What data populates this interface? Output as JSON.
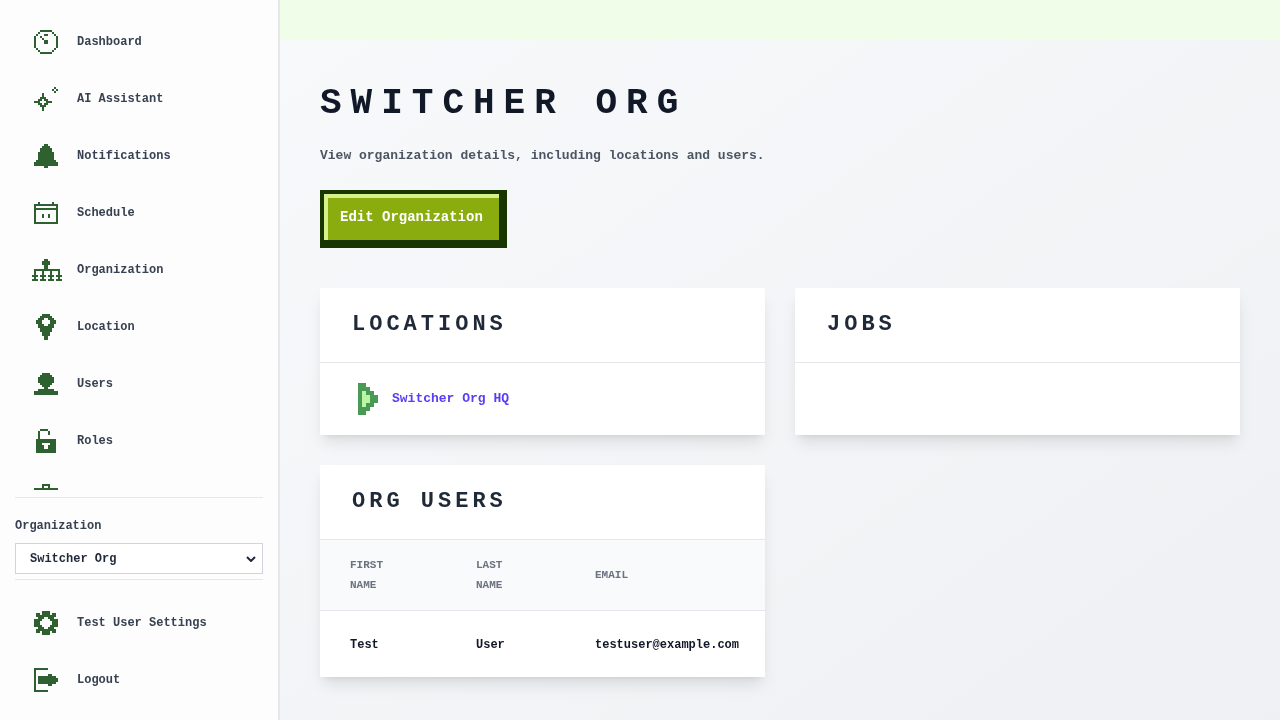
{
  "sidebar": {
    "nav_items": [
      {
        "label": "Dashboard"
      },
      {
        "label": "AI Assistant"
      },
      {
        "label": "Notifications"
      },
      {
        "label": "Schedule"
      },
      {
        "label": "Organization"
      },
      {
        "label": "Location"
      },
      {
        "label": "Users"
      },
      {
        "label": "Roles"
      }
    ],
    "organization_select": {
      "label": "Organization",
      "value": "Switcher Org"
    },
    "footer_items": [
      {
        "label": "Test User Settings"
      },
      {
        "label": "Logout"
      }
    ]
  },
  "page": {
    "title": "SWITCHER ORG",
    "description": "View organization details, including locations and users.",
    "edit_button": "Edit Organization"
  },
  "locations_card": {
    "title": "LOCATIONS",
    "items": [
      {
        "label": "Switcher Org HQ"
      }
    ]
  },
  "jobs_card": {
    "title": "JOBS"
  },
  "org_users_card": {
    "title": "ORG USERS",
    "table": {
      "columns": [
        "FIRST NAME",
        "LAST NAME",
        "EMAIL"
      ],
      "rows": [
        [
          "Test",
          "User",
          "testuser@example.com"
        ]
      ]
    }
  }
}
